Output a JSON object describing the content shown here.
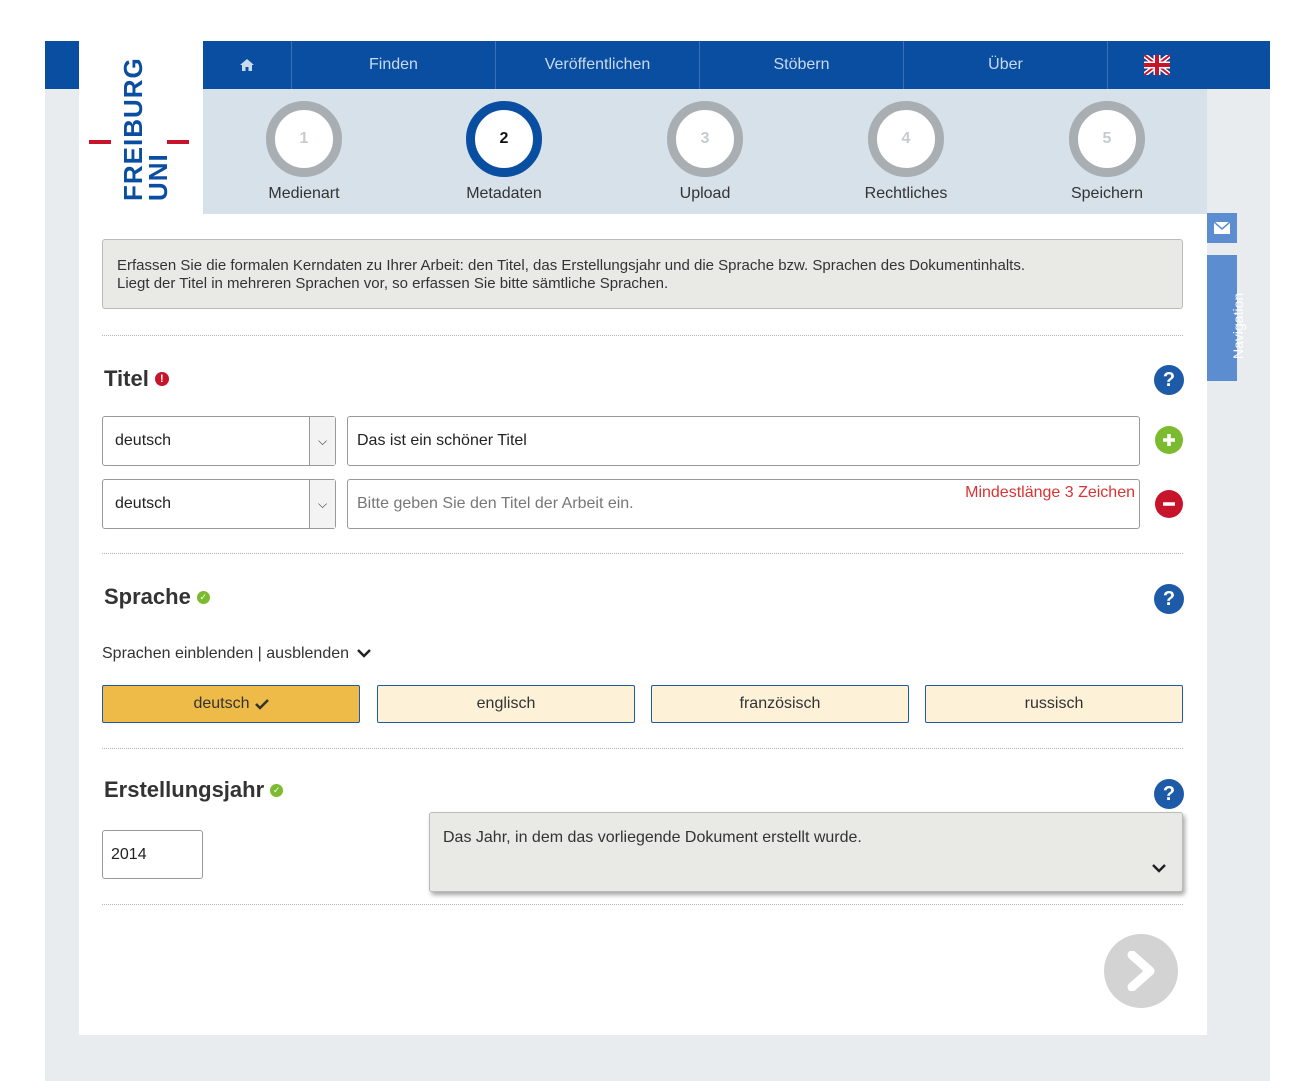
{
  "logo": {
    "line1": "UNI",
    "line2": "FREIBURG"
  },
  "nav": {
    "home_icon": "home-icon",
    "items": [
      "Finden",
      "Veröffentlichen",
      "Stöbern",
      "Über"
    ],
    "language_icon": "uk-flag-icon"
  },
  "steps": [
    {
      "number": "1",
      "label": "Medienart"
    },
    {
      "number": "2",
      "label": "Metadaten"
    },
    {
      "number": "3",
      "label": "Upload"
    },
    {
      "number": "4",
      "label": "Rechtliches"
    },
    {
      "number": "5",
      "label": "Speichern"
    }
  ],
  "active_step": 2,
  "side": {
    "mail_icon": "envelope-icon",
    "navigation_label": "Navigation"
  },
  "info": {
    "line1": "Erfassen Sie die formalen Kerndaten zu Ihrer Arbeit: den Titel, das Erstellungsjahr und die Sprache bzw. Sprachen des Dokumentinhalts.",
    "line2": "Liegt der Titel in mehreren Sprachen vor, so erfassen Sie bitte sämtliche Sprachen."
  },
  "titel": {
    "heading": "Titel",
    "row1": {
      "language": "deutsch",
      "value": "Das ist ein schöner Titel"
    },
    "row2": {
      "language": "deutsch",
      "placeholder": "Bitte geben Sie den Titel der Arbeit ein.",
      "error": "Mindestlänge 3 Zeichen"
    }
  },
  "sprache": {
    "heading": "Sprache",
    "toggle": "Sprachen einblenden | ausblenden",
    "options": [
      {
        "label": "deutsch",
        "selected": true
      },
      {
        "label": "englisch",
        "selected": false
      },
      {
        "label": "französisch",
        "selected": false
      },
      {
        "label": "russisch",
        "selected": false
      }
    ]
  },
  "jahr": {
    "heading": "Erstellungsjahr",
    "value": "2014",
    "tooltip": "Das Jahr, in dem das vorliegende Dokument erstellt wurde."
  },
  "colors": {
    "brand_blue": "#0a4ea1",
    "accent_red": "#c7142b",
    "ok_green": "#7cba2f",
    "selected_yellow": "#efbb48"
  }
}
